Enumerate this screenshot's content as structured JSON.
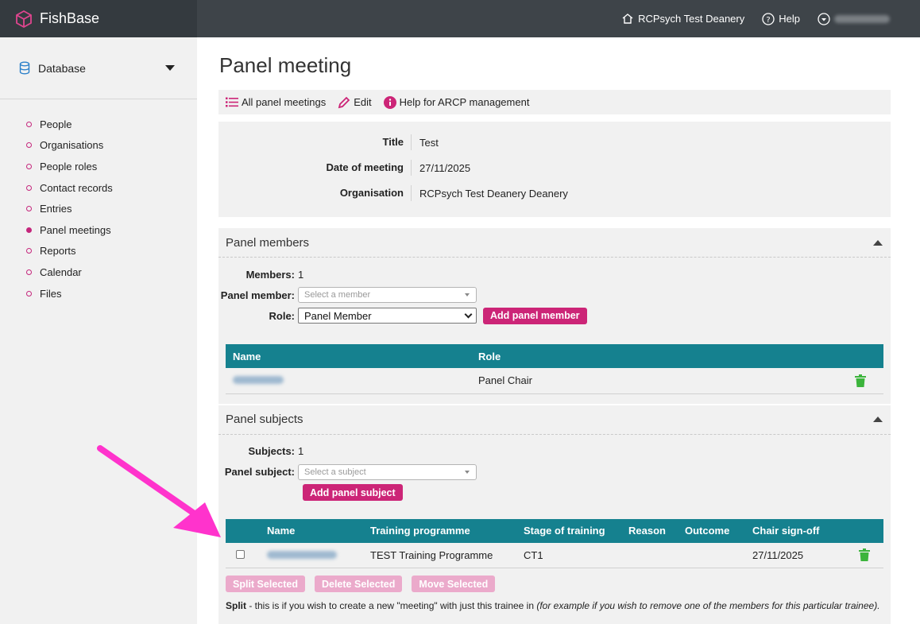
{
  "app": {
    "name": "FishBase"
  },
  "topnav": {
    "org": "RCPsych Test Deanery",
    "help": "Help"
  },
  "sidebar": {
    "database_label": "Database",
    "items": [
      {
        "label": "People",
        "active": false
      },
      {
        "label": "Organisations",
        "active": false
      },
      {
        "label": "People roles",
        "active": false
      },
      {
        "label": "Contact records",
        "active": false
      },
      {
        "label": "Entries",
        "active": false
      },
      {
        "label": "Panel meetings",
        "active": true
      },
      {
        "label": "Reports",
        "active": false
      },
      {
        "label": "Calendar",
        "active": false
      },
      {
        "label": "Files",
        "active": false
      }
    ]
  },
  "page": {
    "title": "Panel meeting"
  },
  "toolbar": {
    "all": "All panel meetings",
    "edit": "Edit",
    "help": "Help for ARCP management"
  },
  "details": {
    "title_label": "Title",
    "title_value": "Test",
    "date_label": "Date of meeting",
    "date_value": "27/11/2025",
    "org_label": "Organisation",
    "org_value": "RCPsych Test Deanery Deanery"
  },
  "members": {
    "heading": "Panel members",
    "count_label": "Members:",
    "count": "1",
    "member_label": "Panel member:",
    "member_placeholder": "Select a member",
    "role_label": "Role:",
    "role_value": "Panel Member",
    "add_button": "Add panel member",
    "columns": {
      "name": "Name",
      "role": "Role"
    },
    "rows": [
      {
        "role": "Panel Chair"
      }
    ]
  },
  "subjects": {
    "heading": "Panel subjects",
    "count_label": "Subjects:",
    "count": "1",
    "subject_label": "Panel subject:",
    "subject_placeholder": "Select a subject",
    "add_button": "Add panel subject",
    "columns": {
      "name": "Name",
      "programme": "Training programme",
      "stage": "Stage of training",
      "reason": "Reason",
      "outcome": "Outcome",
      "signoff": "Chair sign-off"
    },
    "rows": [
      {
        "programme": "TEST Training Programme",
        "stage": "CT1",
        "reason": "",
        "outcome": "",
        "signoff": "27/11/2025"
      }
    ],
    "actions": {
      "split": "Split Selected",
      "delete": "Delete Selected",
      "move": "Move Selected"
    },
    "note_bold": "Split",
    "note_text": " - this is if you wish to create a new \"meeting\" with just this trainee in ",
    "note_italic": "(for example if you wish to remove one of the members for this particular trainee)."
  },
  "colors": {
    "accent": "#cc2577",
    "table_header": "#15818f",
    "trash": "#3cb43c",
    "annotation_arrow": "#ff33cc"
  }
}
